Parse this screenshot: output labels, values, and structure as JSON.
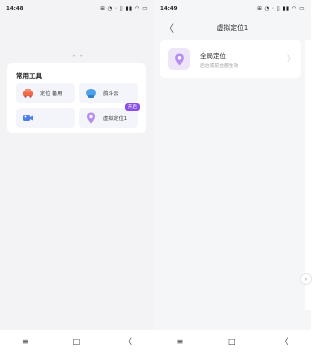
{
  "left_screen": {
    "status": {
      "time": "14:48",
      "icons": "⊞ ◔ ⋅   ▯ ▮▮ ◠ ▭"
    },
    "page_dots": "• • ",
    "tools": {
      "title": "常用工具",
      "items": [
        {
          "label": "定位 备用",
          "icon": "car-icon",
          "badge": ""
        },
        {
          "label": "鸽斗云 ",
          "icon": "hat-icon",
          "badge": ""
        },
        {
          "label": "",
          "icon": "video-icon",
          "badge": ""
        },
        {
          "label": "虚拟定位1",
          "icon": "location-icon",
          "badge": "开启"
        }
      ]
    },
    "nav": {
      "menu": "≡",
      "home": "□",
      "back": "〈"
    }
  },
  "right_screen": {
    "status": {
      "time": "14:49",
      "icons": "⊞ ◔ ⋅   ▯ ▮▮ ◠ ▭"
    },
    "header": {
      "back": "〈",
      "title": "虚拟定位1"
    },
    "location_card": {
      "title": "全局定位",
      "subtitle": "后台或前台都生效",
      "chevron": "〉"
    },
    "nav": {
      "menu": "≡",
      "home": "□",
      "back": "〈"
    }
  },
  "colors": {
    "accent_purple": "#8a4fe6",
    "card_bg": "#ffffff",
    "panel_bg": "#f3f3f5"
  }
}
